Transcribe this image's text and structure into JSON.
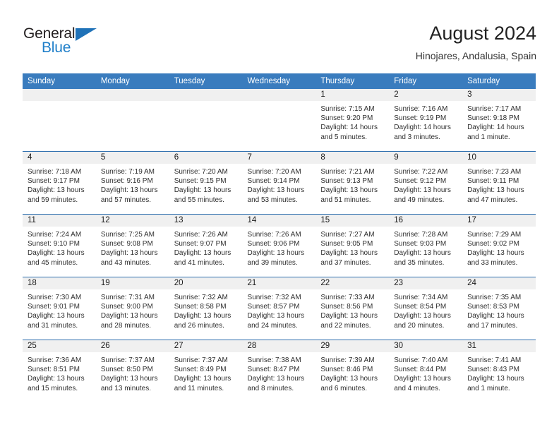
{
  "logo": {
    "word_top": "General",
    "word_bottom": "Blue",
    "triangle_color": "#1f72b8",
    "blue_color": "#1f7fc9"
  },
  "header": {
    "title": "August 2024",
    "location": "Hinojares, Andalusia, Spain"
  },
  "colors": {
    "header_blue": "#3a7cbe",
    "row_divider_blue": "#2f6fae",
    "daynum_gray": "#f0f0f0"
  },
  "weekday_headers": [
    "Sunday",
    "Monday",
    "Tuesday",
    "Wednesday",
    "Thursday",
    "Friday",
    "Saturday"
  ],
  "weeks": [
    [
      {
        "day": "",
        "sunrise": "",
        "sunset": "",
        "daylight_line1": "",
        "daylight_line2": ""
      },
      {
        "day": "",
        "sunrise": "",
        "sunset": "",
        "daylight_line1": "",
        "daylight_line2": ""
      },
      {
        "day": "",
        "sunrise": "",
        "sunset": "",
        "daylight_line1": "",
        "daylight_line2": ""
      },
      {
        "day": "",
        "sunrise": "",
        "sunset": "",
        "daylight_line1": "",
        "daylight_line2": ""
      },
      {
        "day": "1",
        "sunrise": "Sunrise: 7:15 AM",
        "sunset": "Sunset: 9:20 PM",
        "daylight_line1": "Daylight: 14 hours",
        "daylight_line2": "and 5 minutes."
      },
      {
        "day": "2",
        "sunrise": "Sunrise: 7:16 AM",
        "sunset": "Sunset: 9:19 PM",
        "daylight_line1": "Daylight: 14 hours",
        "daylight_line2": "and 3 minutes."
      },
      {
        "day": "3",
        "sunrise": "Sunrise: 7:17 AM",
        "sunset": "Sunset: 9:18 PM",
        "daylight_line1": "Daylight: 14 hours",
        "daylight_line2": "and 1 minute."
      }
    ],
    [
      {
        "day": "4",
        "sunrise": "Sunrise: 7:18 AM",
        "sunset": "Sunset: 9:17 PM",
        "daylight_line1": "Daylight: 13 hours",
        "daylight_line2": "and 59 minutes."
      },
      {
        "day": "5",
        "sunrise": "Sunrise: 7:19 AM",
        "sunset": "Sunset: 9:16 PM",
        "daylight_line1": "Daylight: 13 hours",
        "daylight_line2": "and 57 minutes."
      },
      {
        "day": "6",
        "sunrise": "Sunrise: 7:20 AM",
        "sunset": "Sunset: 9:15 PM",
        "daylight_line1": "Daylight: 13 hours",
        "daylight_line2": "and 55 minutes."
      },
      {
        "day": "7",
        "sunrise": "Sunrise: 7:20 AM",
        "sunset": "Sunset: 9:14 PM",
        "daylight_line1": "Daylight: 13 hours",
        "daylight_line2": "and 53 minutes."
      },
      {
        "day": "8",
        "sunrise": "Sunrise: 7:21 AM",
        "sunset": "Sunset: 9:13 PM",
        "daylight_line1": "Daylight: 13 hours",
        "daylight_line2": "and 51 minutes."
      },
      {
        "day": "9",
        "sunrise": "Sunrise: 7:22 AM",
        "sunset": "Sunset: 9:12 PM",
        "daylight_line1": "Daylight: 13 hours",
        "daylight_line2": "and 49 minutes."
      },
      {
        "day": "10",
        "sunrise": "Sunrise: 7:23 AM",
        "sunset": "Sunset: 9:11 PM",
        "daylight_line1": "Daylight: 13 hours",
        "daylight_line2": "and 47 minutes."
      }
    ],
    [
      {
        "day": "11",
        "sunrise": "Sunrise: 7:24 AM",
        "sunset": "Sunset: 9:10 PM",
        "daylight_line1": "Daylight: 13 hours",
        "daylight_line2": "and 45 minutes."
      },
      {
        "day": "12",
        "sunrise": "Sunrise: 7:25 AM",
        "sunset": "Sunset: 9:08 PM",
        "daylight_line1": "Daylight: 13 hours",
        "daylight_line2": "and 43 minutes."
      },
      {
        "day": "13",
        "sunrise": "Sunrise: 7:26 AM",
        "sunset": "Sunset: 9:07 PM",
        "daylight_line1": "Daylight: 13 hours",
        "daylight_line2": "and 41 minutes."
      },
      {
        "day": "14",
        "sunrise": "Sunrise: 7:26 AM",
        "sunset": "Sunset: 9:06 PM",
        "daylight_line1": "Daylight: 13 hours",
        "daylight_line2": "and 39 minutes."
      },
      {
        "day": "15",
        "sunrise": "Sunrise: 7:27 AM",
        "sunset": "Sunset: 9:05 PM",
        "daylight_line1": "Daylight: 13 hours",
        "daylight_line2": "and 37 minutes."
      },
      {
        "day": "16",
        "sunrise": "Sunrise: 7:28 AM",
        "sunset": "Sunset: 9:03 PM",
        "daylight_line1": "Daylight: 13 hours",
        "daylight_line2": "and 35 minutes."
      },
      {
        "day": "17",
        "sunrise": "Sunrise: 7:29 AM",
        "sunset": "Sunset: 9:02 PM",
        "daylight_line1": "Daylight: 13 hours",
        "daylight_line2": "and 33 minutes."
      }
    ],
    [
      {
        "day": "18",
        "sunrise": "Sunrise: 7:30 AM",
        "sunset": "Sunset: 9:01 PM",
        "daylight_line1": "Daylight: 13 hours",
        "daylight_line2": "and 31 minutes."
      },
      {
        "day": "19",
        "sunrise": "Sunrise: 7:31 AM",
        "sunset": "Sunset: 9:00 PM",
        "daylight_line1": "Daylight: 13 hours",
        "daylight_line2": "and 28 minutes."
      },
      {
        "day": "20",
        "sunrise": "Sunrise: 7:32 AM",
        "sunset": "Sunset: 8:58 PM",
        "daylight_line1": "Daylight: 13 hours",
        "daylight_line2": "and 26 minutes."
      },
      {
        "day": "21",
        "sunrise": "Sunrise: 7:32 AM",
        "sunset": "Sunset: 8:57 PM",
        "daylight_line1": "Daylight: 13 hours",
        "daylight_line2": "and 24 minutes."
      },
      {
        "day": "22",
        "sunrise": "Sunrise: 7:33 AM",
        "sunset": "Sunset: 8:56 PM",
        "daylight_line1": "Daylight: 13 hours",
        "daylight_line2": "and 22 minutes."
      },
      {
        "day": "23",
        "sunrise": "Sunrise: 7:34 AM",
        "sunset": "Sunset: 8:54 PM",
        "daylight_line1": "Daylight: 13 hours",
        "daylight_line2": "and 20 minutes."
      },
      {
        "day": "24",
        "sunrise": "Sunrise: 7:35 AM",
        "sunset": "Sunset: 8:53 PM",
        "daylight_line1": "Daylight: 13 hours",
        "daylight_line2": "and 17 minutes."
      }
    ],
    [
      {
        "day": "25",
        "sunrise": "Sunrise: 7:36 AM",
        "sunset": "Sunset: 8:51 PM",
        "daylight_line1": "Daylight: 13 hours",
        "daylight_line2": "and 15 minutes."
      },
      {
        "day": "26",
        "sunrise": "Sunrise: 7:37 AM",
        "sunset": "Sunset: 8:50 PM",
        "daylight_line1": "Daylight: 13 hours",
        "daylight_line2": "and 13 minutes."
      },
      {
        "day": "27",
        "sunrise": "Sunrise: 7:37 AM",
        "sunset": "Sunset: 8:49 PM",
        "daylight_line1": "Daylight: 13 hours",
        "daylight_line2": "and 11 minutes."
      },
      {
        "day": "28",
        "sunrise": "Sunrise: 7:38 AM",
        "sunset": "Sunset: 8:47 PM",
        "daylight_line1": "Daylight: 13 hours",
        "daylight_line2": "and 8 minutes."
      },
      {
        "day": "29",
        "sunrise": "Sunrise: 7:39 AM",
        "sunset": "Sunset: 8:46 PM",
        "daylight_line1": "Daylight: 13 hours",
        "daylight_line2": "and 6 minutes."
      },
      {
        "day": "30",
        "sunrise": "Sunrise: 7:40 AM",
        "sunset": "Sunset: 8:44 PM",
        "daylight_line1": "Daylight: 13 hours",
        "daylight_line2": "and 4 minutes."
      },
      {
        "day": "31",
        "sunrise": "Sunrise: 7:41 AM",
        "sunset": "Sunset: 8:43 PM",
        "daylight_line1": "Daylight: 13 hours",
        "daylight_line2": "and 1 minute."
      }
    ]
  ]
}
